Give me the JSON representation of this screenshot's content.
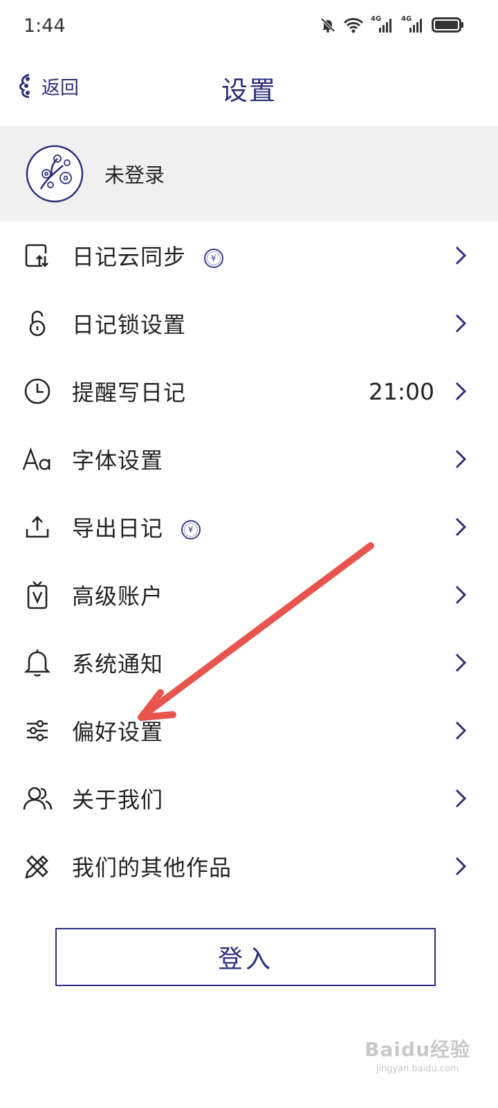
{
  "status_bar": {
    "time": "1:44",
    "icons": [
      "mute-bell-icon",
      "wifi-icon",
      "signal-4g-icon",
      "signal-4g-icon",
      "battery-icon"
    ],
    "network_label": "4G"
  },
  "header": {
    "back_label": "返回",
    "title": "设置"
  },
  "profile": {
    "name": "未登录",
    "avatar_icon": "plum-blossom-avatar-icon"
  },
  "menu": {
    "items": [
      {
        "label": "日记云同步",
        "icon": "cloud-sync-icon",
        "premium": true,
        "value": ""
      },
      {
        "label": "日记锁设置",
        "icon": "lock-icon",
        "premium": false,
        "value": ""
      },
      {
        "label": "提醒写日记",
        "icon": "clock-icon",
        "premium": false,
        "value": "21:00"
      },
      {
        "label": "字体设置",
        "icon": "font-icon",
        "premium": false,
        "value": ""
      },
      {
        "label": "导出日记",
        "icon": "export-icon",
        "premium": true,
        "value": ""
      },
      {
        "label": "高级账户",
        "icon": "vip-card-icon",
        "premium": false,
        "value": ""
      },
      {
        "label": "系统通知",
        "icon": "bell-icon",
        "premium": false,
        "value": ""
      },
      {
        "label": "偏好设置",
        "icon": "sliders-icon",
        "premium": false,
        "value": ""
      },
      {
        "label": "关于我们",
        "icon": "people-icon",
        "premium": false,
        "value": ""
      },
      {
        "label": "我们的其他作品",
        "icon": "pencil-ruler-icon",
        "premium": false,
        "value": ""
      }
    ],
    "premium_badge": "¥"
  },
  "login_button": {
    "label": "登入"
  },
  "annotation": {
    "color": "#e8554f",
    "points_to": "偏好设置"
  },
  "watermark": {
    "main": "Baidu经验",
    "sub": "jingyan.baidu.com"
  },
  "colors": {
    "accent": "#2b2f7a",
    "profile_bg": "#f0f0f0",
    "text": "#222222"
  }
}
